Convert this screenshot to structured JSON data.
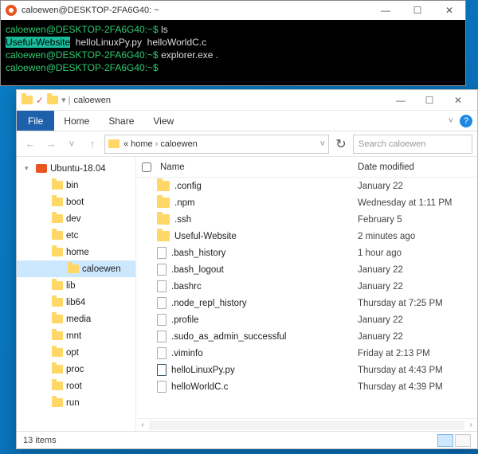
{
  "terminal": {
    "title": "caloewen@DESKTOP-2FA6G40: ~",
    "lines": {
      "p1": "caloewen@DESKTOP-2FA6G40:",
      "path1": "~$ ",
      "cmd1": "ls",
      "out_hl": "Useful-Website",
      "out_rest": "  helloLinuxPy.py  helloWorldC.c",
      "p2": "caloewen@DESKTOP-2FA6G40:",
      "path2": "~$ ",
      "cmd2": "explorer.exe .",
      "p3": "caloewen@DESKTOP-2FA6G40:",
      "path3": "~$ "
    }
  },
  "explorer": {
    "title": "caloewen",
    "ribbon": {
      "file": "File",
      "home": "Home",
      "share": "Share",
      "view": "View"
    },
    "breadcrumb": {
      "p1": "«",
      "p2": "home",
      "p3": "caloewen"
    },
    "search_placeholder": "Search caloewen",
    "columns": {
      "name": "Name",
      "date": "Date modified"
    },
    "tree": {
      "root": "Ubuntu-18.04",
      "items": [
        "bin",
        "boot",
        "dev",
        "etc",
        "home",
        "lib",
        "lib64",
        "media",
        "mnt",
        "opt",
        "proc",
        "root",
        "run"
      ],
      "selected": "caloewen"
    },
    "files": [
      {
        "name": ".config",
        "date": "January 22",
        "type": "folder"
      },
      {
        "name": ".npm",
        "date": "Wednesday at 1:11 PM",
        "type": "folder"
      },
      {
        "name": ".ssh",
        "date": "February 5",
        "type": "folder"
      },
      {
        "name": "Useful-Website",
        "date": "2 minutes ago",
        "type": "folder"
      },
      {
        "name": ".bash_history",
        "date": "1 hour ago",
        "type": "file"
      },
      {
        "name": ".bash_logout",
        "date": "January 22",
        "type": "file"
      },
      {
        "name": ".bashrc",
        "date": "January 22",
        "type": "file"
      },
      {
        "name": ".node_repl_history",
        "date": "Thursday at 7:25 PM",
        "type": "file"
      },
      {
        "name": ".profile",
        "date": "January 22",
        "type": "file"
      },
      {
        "name": ".sudo_as_admin_successful",
        "date": "January 22",
        "type": "file"
      },
      {
        "name": ".viminfo",
        "date": "Friday at 2:13 PM",
        "type": "file"
      },
      {
        "name": "helloLinuxPy.py",
        "date": "Thursday at 4:43 PM",
        "type": "py"
      },
      {
        "name": "helloWorldC.c",
        "date": "Thursday at 4:39 PM",
        "type": "file"
      }
    ],
    "status": "13 items"
  }
}
